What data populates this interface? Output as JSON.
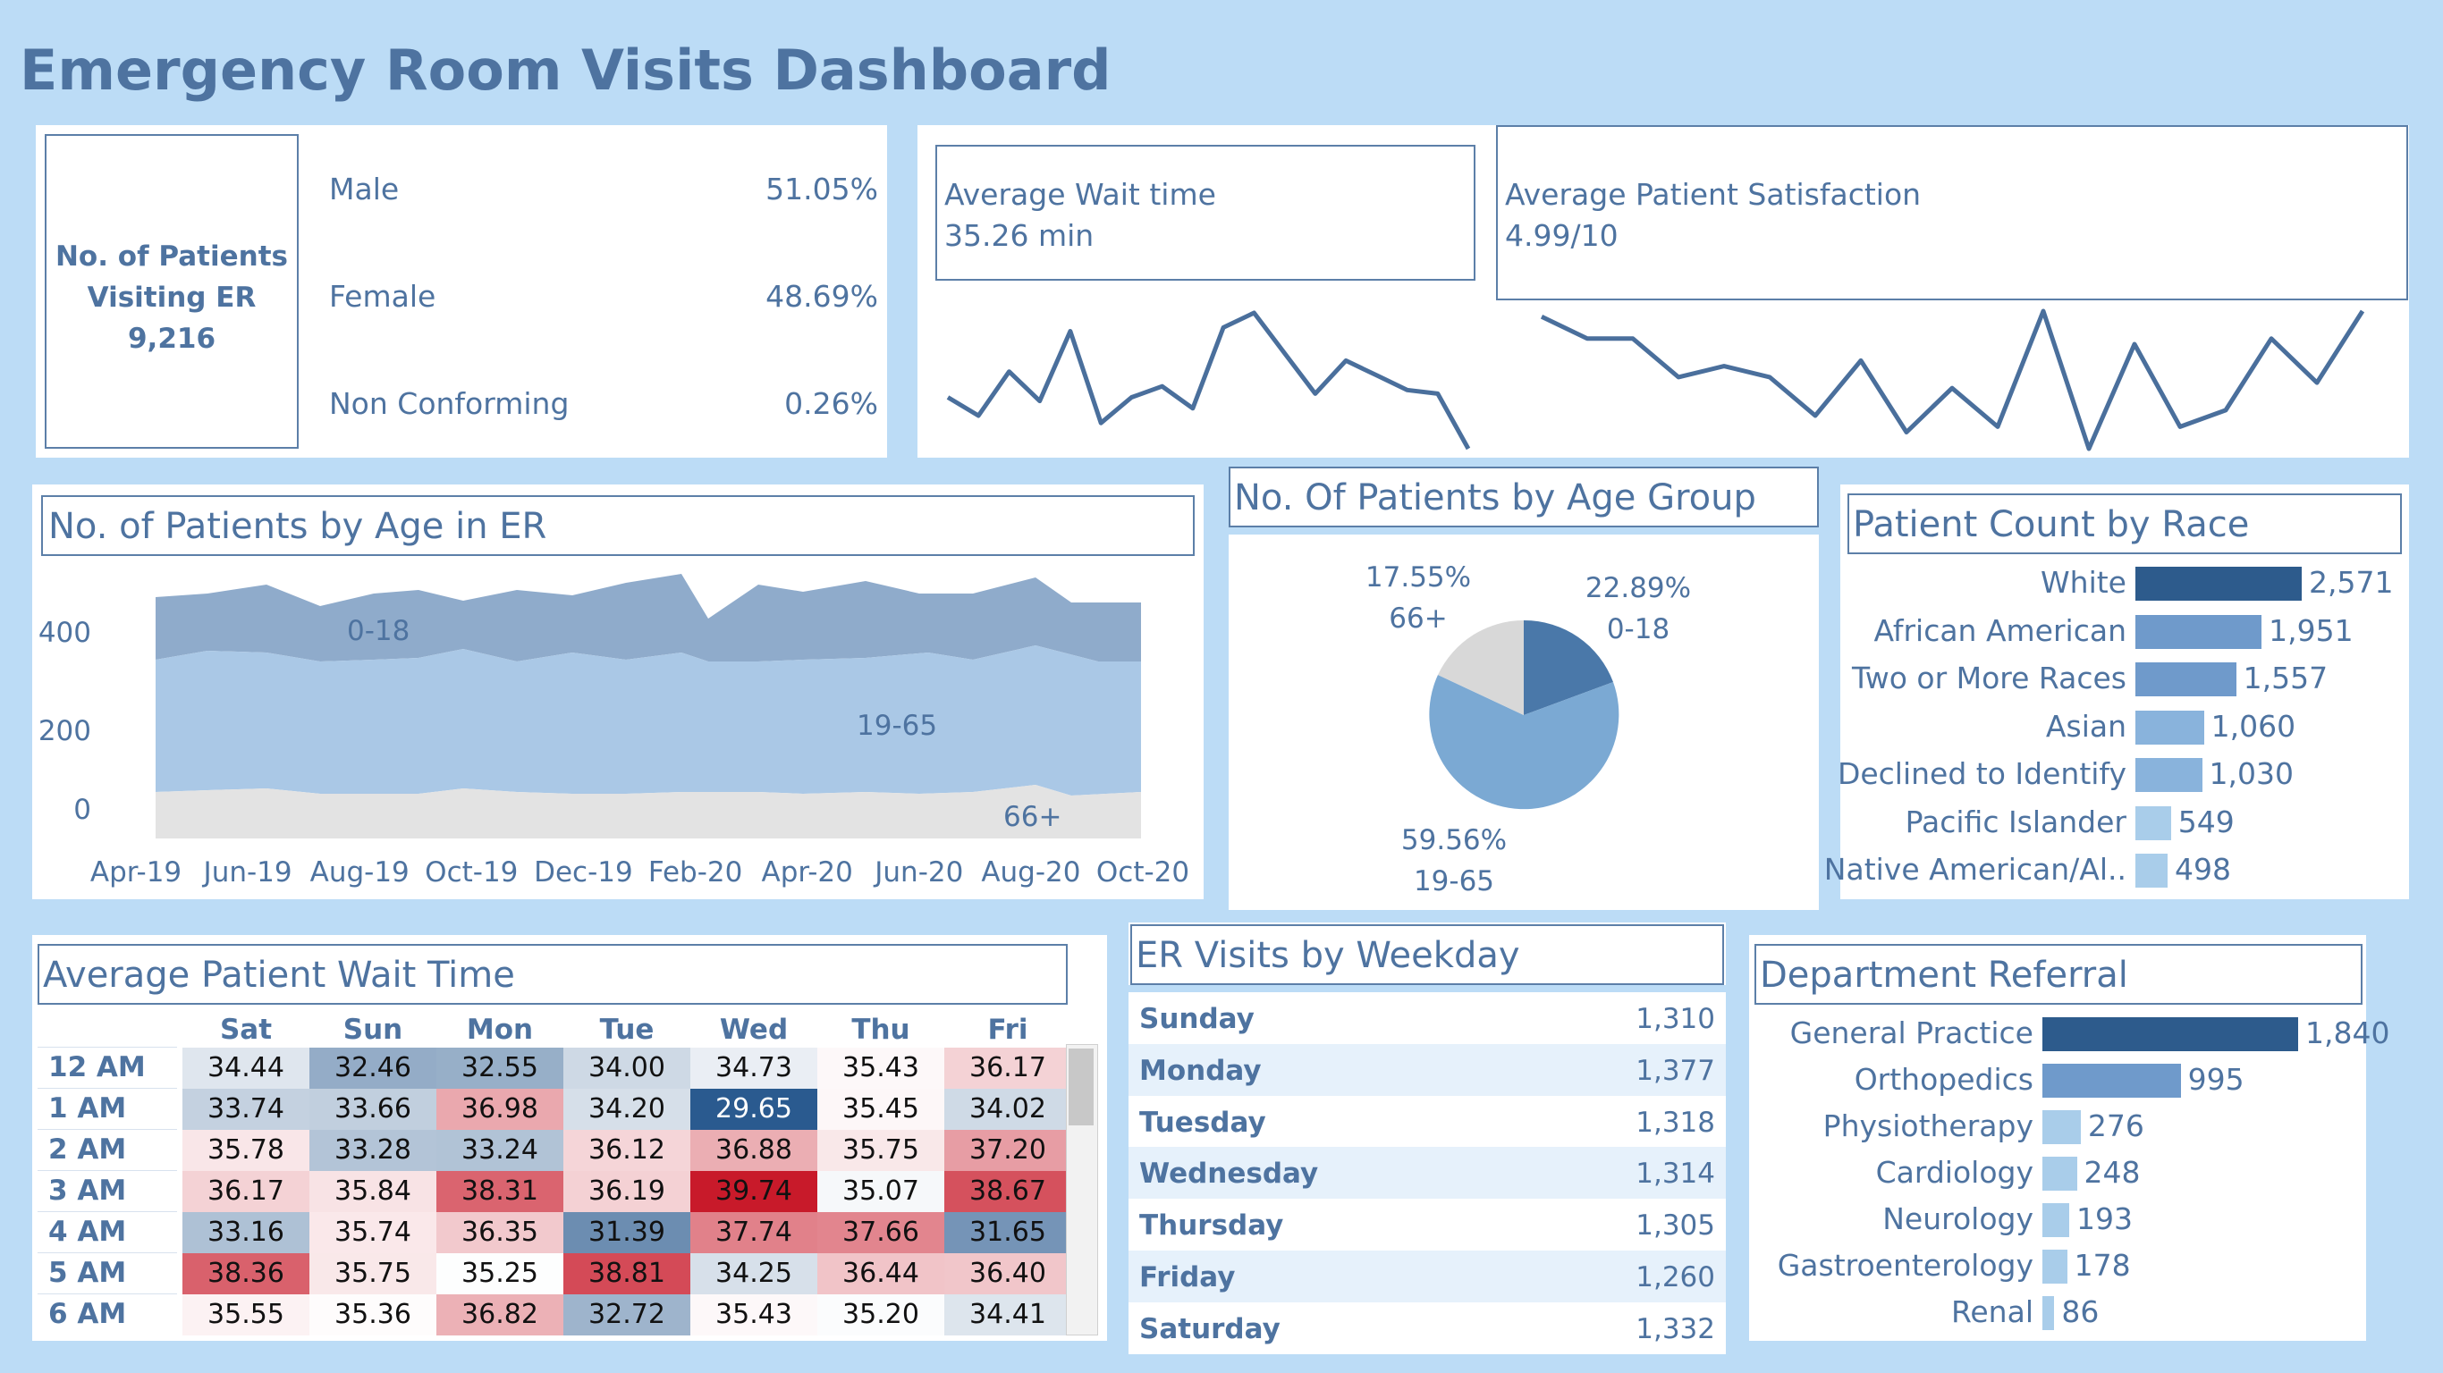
{
  "dashboard_title": "Emergency Room Visits Dashboard",
  "kpi": {
    "patients_label_1": "No. of Patients",
    "patients_label_2": "Visiting ER",
    "patients_value": "9,216",
    "gender": [
      {
        "label": "Male",
        "value": "51.05%"
      },
      {
        "label": "Female",
        "value": "48.69%"
      },
      {
        "label": "Non Conforming",
        "value": "0.26%"
      }
    ]
  },
  "wait_time": {
    "label": "Average Wait time",
    "value": "35.26 min",
    "sparkline": [
      34.6,
      34.1,
      35.3,
      34.5,
      36.4,
      33.9,
      34.6,
      34.9,
      34.3,
      36.5,
      36.9,
      35.8,
      34.7,
      35.6,
      35.2,
      34.8,
      34.7,
      33.2
    ]
  },
  "satisfaction": {
    "label": "Average Patient Satisfaction",
    "value": "4.99/10",
    "sparkline": [
      5.7,
      5.3,
      5.3,
      4.6,
      4.8,
      4.6,
      3.9,
      4.9,
      3.6,
      4.4,
      3.7,
      5.8,
      3.3,
      5.2,
      3.7,
      4.0,
      5.3,
      4.5,
      5.8
    ]
  },
  "age_area": {
    "title": "No. of Patients by Age in ER",
    "x_ticks": [
      "Apr-19",
      "Jun-19",
      "Aug-19",
      "Oct-19",
      "Dec-19",
      "Feb-20",
      "Apr-20",
      "Jun-20",
      "Aug-20",
      "Oct-20"
    ],
    "y_ticks": [
      "0",
      "200",
      "400"
    ],
    "series_labels": [
      "0-18",
      "19-65",
      "66+"
    ]
  },
  "age_group": {
    "title": "No. Of Patients by Age Group",
    "slices": [
      {
        "pct": "22.89%",
        "label": "0-18"
      },
      {
        "pct": "59.56%",
        "label": "19-65"
      },
      {
        "pct": "17.55%",
        "label": "66+"
      }
    ]
  },
  "race": {
    "title": "Patient Count by Race",
    "rows": [
      {
        "label": "White",
        "value": "2,571"
      },
      {
        "label": "African American",
        "value": "1,951"
      },
      {
        "label": "Two or More Races",
        "value": "1,557"
      },
      {
        "label": "Asian",
        "value": "1,060"
      },
      {
        "label": "Declined to Identify",
        "value": "1,030"
      },
      {
        "label": "Pacific Islander",
        "value": "549"
      },
      {
        "label": "Native American/Al..",
        "value": "498"
      }
    ]
  },
  "heatmap": {
    "title": "Average Patient Wait Time",
    "cols": [
      "Sat",
      "Sun",
      "Mon",
      "Tue",
      "Wed",
      "Thu",
      "Fri"
    ],
    "rows": [
      {
        "label": "12 AM",
        "values": [
          "34.44",
          "32.46",
          "32.55",
          "34.00",
          "34.73",
          "35.43",
          "36.17"
        ]
      },
      {
        "label": "1 AM",
        "values": [
          "33.74",
          "33.66",
          "36.98",
          "34.20",
          "29.65",
          "35.45",
          "34.02"
        ]
      },
      {
        "label": "2 AM",
        "values": [
          "35.78",
          "33.28",
          "33.24",
          "36.12",
          "36.88",
          "35.75",
          "37.20"
        ]
      },
      {
        "label": "3 AM",
        "values": [
          "36.17",
          "35.84",
          "38.31",
          "36.19",
          "39.74",
          "35.07",
          "38.67"
        ]
      },
      {
        "label": "4 AM",
        "values": [
          "33.16",
          "35.74",
          "36.35",
          "31.39",
          "37.74",
          "37.66",
          "31.65"
        ]
      },
      {
        "label": "5 AM",
        "values": [
          "38.36",
          "35.75",
          "35.25",
          "38.81",
          "34.25",
          "36.44",
          "36.40"
        ]
      },
      {
        "label": "6 AM",
        "values": [
          "35.55",
          "35.36",
          "36.82",
          "32.72",
          "35.43",
          "35.20",
          "34.41"
        ]
      }
    ]
  },
  "weekday": {
    "title": "ER Visits by Weekday",
    "rows": [
      {
        "label": "Sunday",
        "value": "1,310"
      },
      {
        "label": "Monday",
        "value": "1,377"
      },
      {
        "label": "Tuesday",
        "value": "1,318"
      },
      {
        "label": "Wednesday",
        "value": "1,314"
      },
      {
        "label": "Thursday",
        "value": "1,305"
      },
      {
        "label": "Friday",
        "value": "1,260"
      },
      {
        "label": "Saturday",
        "value": "1,332"
      }
    ]
  },
  "department": {
    "title": "Department Referral",
    "rows": [
      {
        "label": "General Practice",
        "value": "1,840"
      },
      {
        "label": "Orthopedics",
        "value": "995"
      },
      {
        "label": "Physiotherapy",
        "value": "276"
      },
      {
        "label": "Cardiology",
        "value": "248"
      },
      {
        "label": "Neurology",
        "value": "193"
      },
      {
        "label": "Gastroenterology",
        "value": "178"
      },
      {
        "label": "Renal",
        "value": "86"
      }
    ]
  },
  "colors": {
    "background": "#bcdcf6",
    "title": "#4e73a0",
    "line": "#4a6f9c",
    "bar_dark": "#2d5b8c",
    "bar_mid": "#5f8ec1",
    "bar_light": "#a9cdea",
    "heat_blue": "#2a5a8f",
    "heat_red": "#c81a2a"
  }
}
